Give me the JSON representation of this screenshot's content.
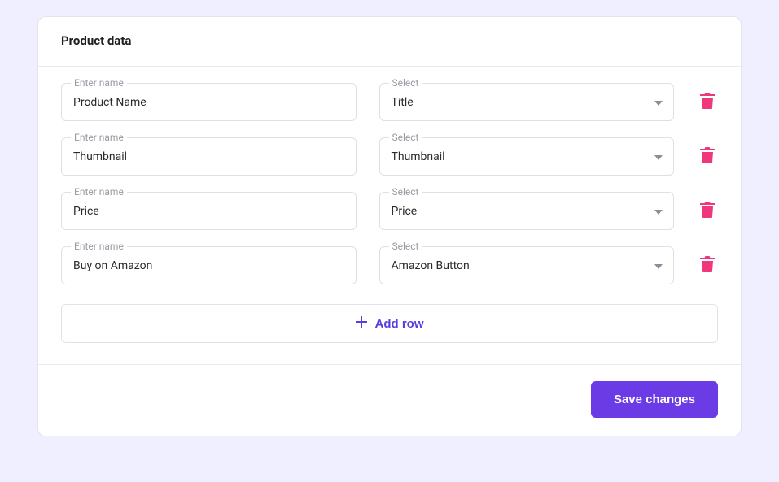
{
  "panel": {
    "title": "Product data",
    "rows": [
      {
        "name_label": "Enter name",
        "name_value": "Product Name",
        "select_label": "Select",
        "select_value": "Title"
      },
      {
        "name_label": "Enter name",
        "name_value": "Thumbnail",
        "select_label": "Select",
        "select_value": "Thumbnail"
      },
      {
        "name_label": "Enter name",
        "name_value": "Price",
        "select_label": "Select",
        "select_value": "Price"
      },
      {
        "name_label": "Enter name",
        "name_value": "Buy on Amazon",
        "select_label": "Select",
        "select_value": "Amazon Button"
      }
    ],
    "add_row_label": "Add row",
    "save_label": "Save changes"
  },
  "colors": {
    "accent": "#6b3ce6",
    "danger": "#f0377e"
  }
}
